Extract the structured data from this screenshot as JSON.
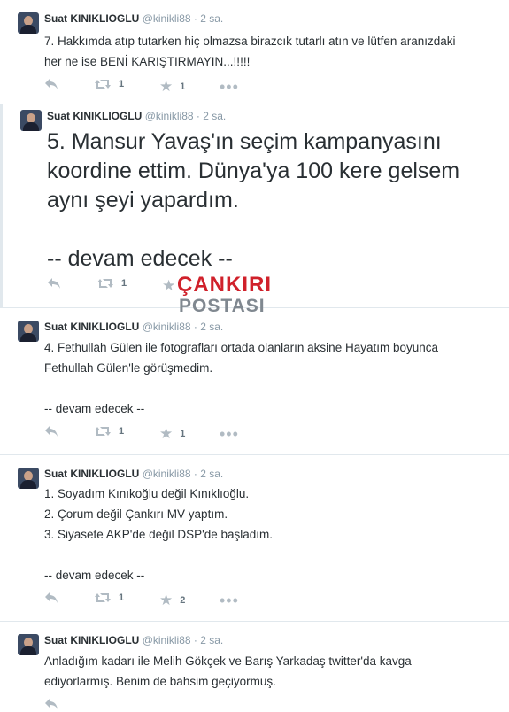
{
  "tweets": [
    {
      "name": "Suat KINIKLIOGLU",
      "handle": "@kinikli88",
      "time": "· 2 sa.",
      "text": "7. Hakkımda atıp tutarken hiç olmazsa birazcık tutarlı atın ve lütfen aranızdaki\nher ne ise BENİ KARIŞTIRMAYIN...!!!!!",
      "retweets": "1",
      "favorites": "1"
    },
    {
      "name": "Suat KINIKLIOGLU",
      "handle": "@kinikli88",
      "time": "· 2 sa.",
      "text": "5. Mansur Yavaş'ın seçim kampanyasını\nkoordine ettim. Dünya'ya 100 kere gelsem\naynı şeyi yapardım.\n\n-- devam edecek --",
      "retweets": "1",
      "favorites": ""
    },
    {
      "name": "Suat KINIKLIOGLU",
      "handle": "@kinikli88",
      "time": "· 2 sa.",
      "text": "4. Fethullah Gülen ile fotografları ortada olanların aksine Hayatım boyunca\nFethullah Gülen'le görüşmedim.\n\n-- devam edecek --",
      "retweets": "1",
      "favorites": "1"
    },
    {
      "name": "Suat KINIKLIOGLU",
      "handle": "@kinikli88",
      "time": "· 2 sa.",
      "text": "1. Soyadım Kınıkoğlu değil Kınıklıoğlu.\n2. Çorum değil Çankırı MV yaptım.\n3. Siyasete AKP'de değil DSP'de başladım.\n\n-- devam edecek --",
      "retweets": "1",
      "favorites": "2"
    },
    {
      "name": "Suat KINIKLIOGLU",
      "handle": "@kinikli88",
      "time": "· 2 sa.",
      "text": "Anladığım kadarı ile Melih Gökçek ve Barış Yarkadaş twitter'da kavga\nediyorlarmış. Benim de bahsim geçiyormuş.",
      "retweets": "",
      "favorites": ""
    }
  ],
  "watermark": {
    "top": "ÇANKIRI",
    "bottom": "POSTASI"
  }
}
